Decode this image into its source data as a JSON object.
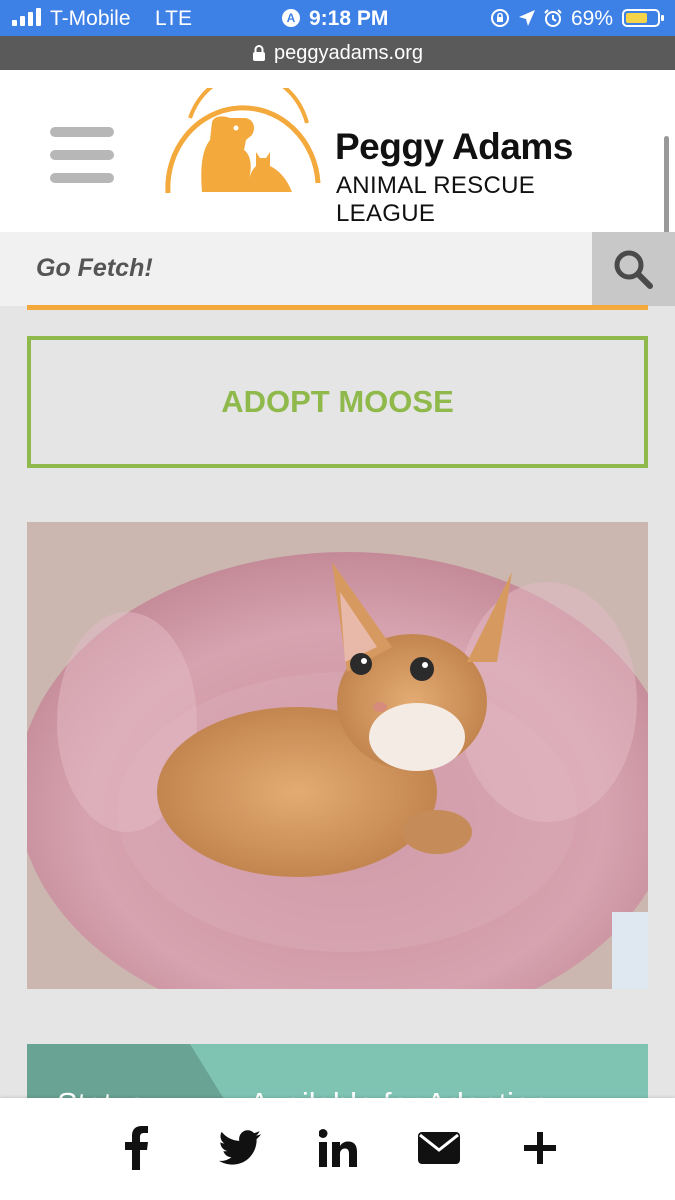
{
  "status_bar": {
    "carrier": "T-Mobile",
    "network": "LTE",
    "time": "9:18 PM",
    "battery": "69%",
    "battery_level": 0.69
  },
  "browser": {
    "url": "peggyadams.org"
  },
  "header": {
    "logo_line1": "Peggy Adams",
    "logo_line2": "ANIMAL RESCUE LEAGUE",
    "logo_colors": {
      "orange": "#f4a93c",
      "text": "#111111"
    }
  },
  "search": {
    "placeholder": "Go Fetch!"
  },
  "adopt": {
    "label": "ADOPT MOOSE",
    "color": "#8fb94b"
  },
  "status_panel": {
    "label": "Status",
    "value": "Available for Adoption"
  },
  "share": {
    "icons": [
      "facebook-icon",
      "twitter-icon",
      "linkedin-icon",
      "email-icon",
      "plus-icon"
    ]
  },
  "colors": {
    "accent_orange": "#f4a93c",
    "accent_green": "#8fb94b",
    "teal": "#7fc3b3"
  }
}
